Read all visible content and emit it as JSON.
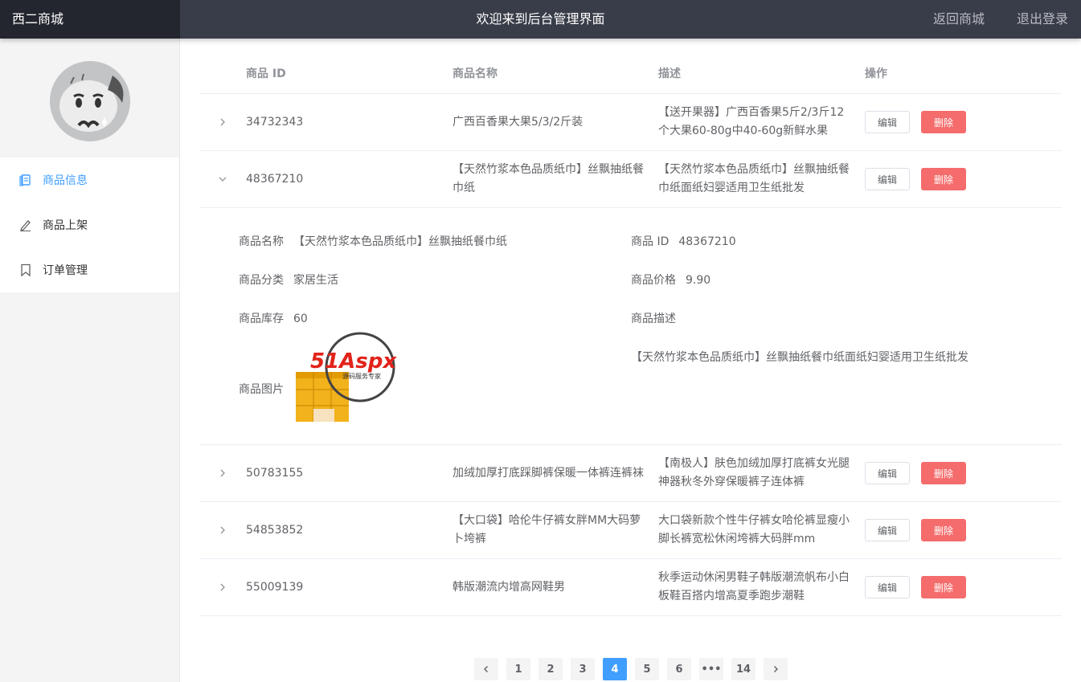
{
  "header": {
    "brand": "西二商城",
    "welcome": "欢迎来到后台管理界面",
    "back_link": "返回商城",
    "logout_link": "退出登录"
  },
  "sidebar": {
    "items": [
      {
        "label": "商品信息",
        "icon": "document-icon",
        "active": true
      },
      {
        "label": "商品上架",
        "icon": "edit-icon",
        "active": false
      },
      {
        "label": "订单管理",
        "icon": "bookmark-icon",
        "active": false
      }
    ]
  },
  "table": {
    "columns": [
      "商品 ID",
      "商品名称",
      "描述",
      "操作"
    ],
    "edit_label": "编辑",
    "delete_label": "删除",
    "rows": [
      {
        "id": "34732343",
        "name": "广西百香果大果5/3/2斤装",
        "desc": "【送开果器】广西百香果5斤2/3斤12个大果60-80g中40-60g新鲜水果"
      },
      {
        "id": "48367210",
        "name": "【天然竹浆本色品质纸巾】丝飘抽纸餐巾纸",
        "desc": "【天然竹浆本色品质纸巾】丝飘抽纸餐巾纸面纸妇婴适用卫生纸批发"
      },
      {
        "id": "50783155",
        "name": "加绒加厚打底踩脚裤保暖一体裤连裤袜",
        "desc": "【南极人】肤色加绒加厚打底裤女光腿神器秋冬外穿保暖裤子连体裤"
      },
      {
        "id": "54853852",
        "name": "【大口袋】哈伦牛仔裤女胖MM大码萝卜垮裤",
        "desc": "大口袋新款个性牛仔裤女哈伦裤显瘦小脚长裤宽松休闲垮裤大码胖mm"
      },
      {
        "id": "55009139",
        "name": "韩版潮流内增高网鞋男",
        "desc": "秋季运动休闲男鞋子韩版潮流帆布小白板鞋百搭内增高夏季跑步潮鞋"
      }
    ]
  },
  "detail": {
    "name_label": "商品名称",
    "name_value": "【天然竹浆本色品质纸巾】丝飘抽纸餐巾纸",
    "id_label": "商品 ID",
    "id_value": "48367210",
    "category_label": "商品分类",
    "category_value": "家居生活",
    "price_label": "商品价格",
    "price_value": "9.90",
    "stock_label": "商品库存",
    "stock_value": "60",
    "desc_label": "商品描述",
    "desc_value": "【天然竹浆本色品质纸巾】丝飘抽纸餐巾纸面纸妇婴适用卫生纸批发",
    "image_label": "商品图片",
    "watermark": "51Aspx",
    "watermark_sub": "源码服务专家"
  },
  "pagination": {
    "pages": [
      "1",
      "2",
      "3",
      "4",
      "5",
      "6",
      "•••",
      "14"
    ],
    "current": "4"
  },
  "colors": {
    "primary": "#409eff",
    "danger": "#f56c6c",
    "header_bg": "#393d49",
    "brand_bg": "#23262e"
  }
}
